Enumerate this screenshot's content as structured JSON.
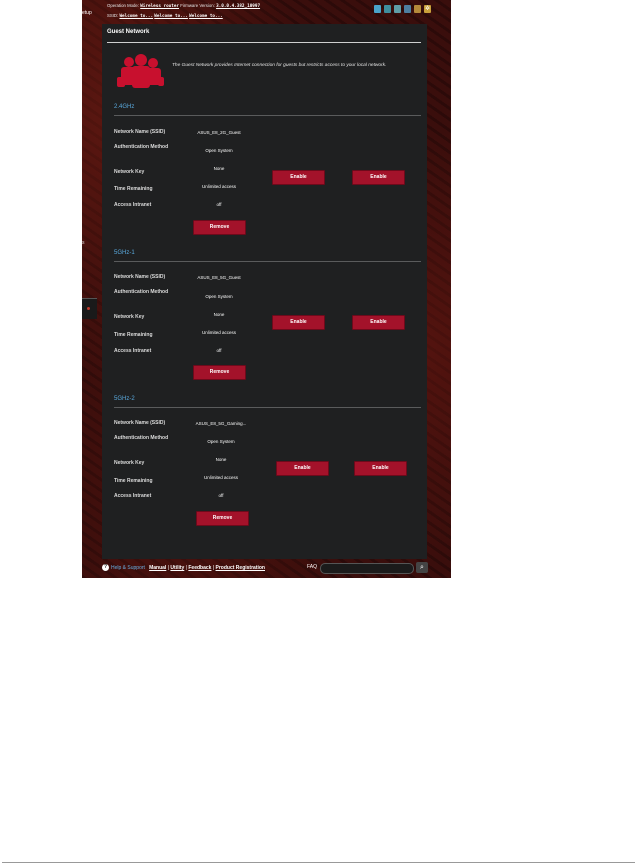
{
  "header": {
    "operation_mode_label": "Operation Mode:",
    "operation_mode_value": "Wireless router",
    "firmware_label": "Firmware Version:",
    "firmware_value": "3.0.0.4.382_10997",
    "ssid_label": "SSID:",
    "ssid_values": [
      "Welcome to...",
      "Welcome to...",
      "Welcome to..."
    ],
    "setup_label": "etup"
  },
  "panel": {
    "title": "Guest Network",
    "description": "The Guest Network provides Internet connection for guests but restricts access to your local network."
  },
  "field_labels": {
    "ssid": "Network Name (SSID)",
    "auth": "Authentication Method",
    "key": "Network Key",
    "time": "Time Remaining",
    "intranet": "Access Intranet"
  },
  "bands": [
    {
      "name": "2.4GHz",
      "ssid": "ASUS_E8_2G_Guest",
      "auth": "Open System",
      "key": "None",
      "time": "Unlimited access",
      "intranet": "off",
      "remove_label": "Remove",
      "enable_label_1": "Enable",
      "enable_label_2": "Enable"
    },
    {
      "name": "5GHz-1",
      "ssid": "ASUS_E8_5G_Guest",
      "auth": "Open System",
      "key": "None",
      "time": "Unlimited access",
      "intranet": "off",
      "remove_label": "Remove",
      "enable_label_1": "Enable",
      "enable_label_2": "Enable"
    },
    {
      "name": "5GHz-2",
      "ssid": "ASUS_E8_5G_Gaming...",
      "auth": "Open System",
      "key": "None",
      "time": "Unlimited access",
      "intranet": "off",
      "remove_label": "Remove",
      "enable_label_1": "Enable",
      "enable_label_2": "Enable"
    }
  ],
  "footer": {
    "help_label": "Help & Support",
    "links": [
      "Manual",
      "Utility",
      "Feedback",
      "Product Registration"
    ],
    "faq_label": "FAQ"
  },
  "left_nav": {
    "item_label": "s"
  },
  "colors": {
    "accent_red": "#a3122a",
    "band_blue": "#5aa9dd",
    "panel_bg": "#1f2021"
  }
}
